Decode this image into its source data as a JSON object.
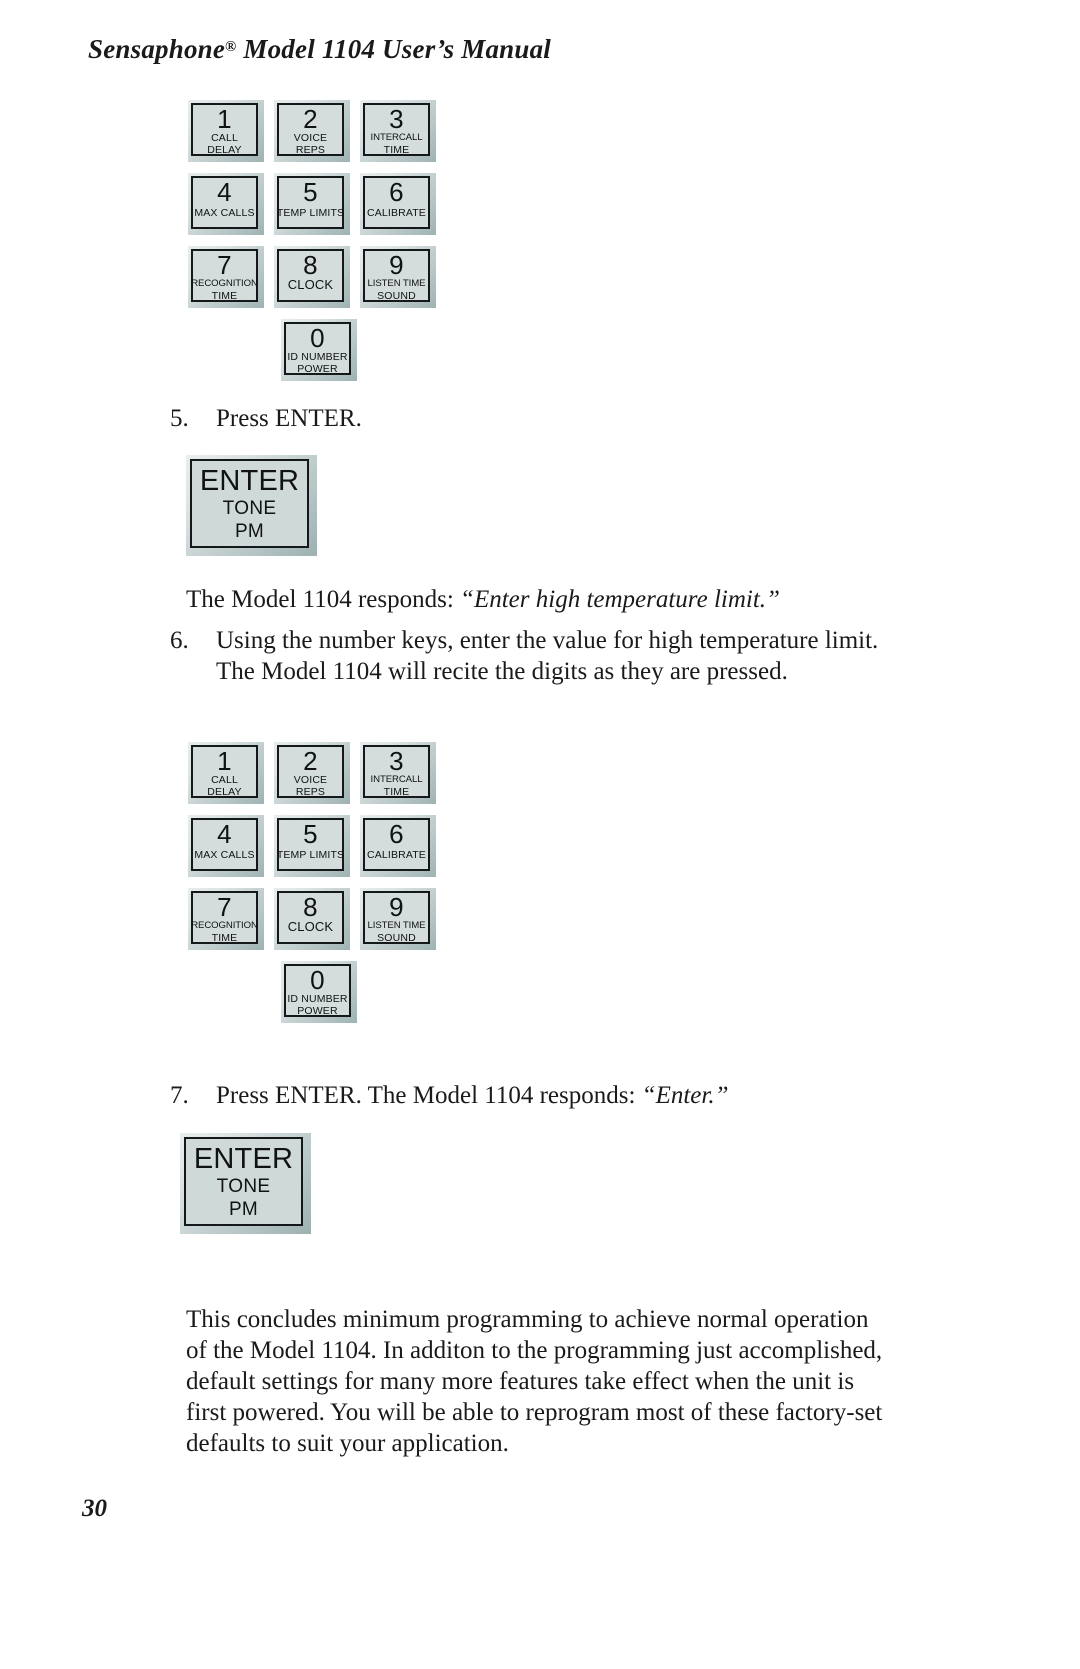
{
  "header": {
    "brand": "Sensaphone",
    "registered_mark": "®",
    "title_rest": " Model 1104 User’s Manual"
  },
  "keypad": {
    "keys": [
      {
        "digit": "1",
        "sub1": "CALL",
        "sub2": "DELAY"
      },
      {
        "digit": "2",
        "sub1": "VOICE",
        "sub2": "REPS"
      },
      {
        "digit": "3",
        "sub1": "INTERCALL",
        "sub2": "TIME"
      },
      {
        "digit": "4",
        "sub1": "MAX CALLS",
        "sub2": ""
      },
      {
        "digit": "5",
        "sub1": "TEMP LIMITS",
        "sub2": ""
      },
      {
        "digit": "6",
        "sub1": "CALIBRATE",
        "sub2": ""
      },
      {
        "digit": "7",
        "sub1": "RECOGNITION",
        "sub2": "TIME"
      },
      {
        "digit": "8",
        "sub1": "CLOCK",
        "sub2": ""
      },
      {
        "digit": "9",
        "sub1": "LISTEN TIME",
        "sub2": "SOUND"
      },
      {
        "digit": "0",
        "sub1": "ID NUMBER",
        "sub2": "POWER"
      }
    ]
  },
  "enter_key": {
    "label": "ENTER",
    "sub1": "TONE",
    "sub2": "PM"
  },
  "steps": {
    "step5": {
      "number": "5.",
      "text": "Press ENTER."
    },
    "response5": {
      "lead": "The Model 1104 responds: ",
      "quote": "“Enter high temperature limit.”"
    },
    "step6": {
      "number": "6.",
      "text": "Using the number keys, enter the value for high temperature limit. The Model 1104 will recite the digits as they are pressed."
    },
    "step7": {
      "number": "7.",
      "lead": "Press ENTER. The Model 1104 responds: ",
      "quote": "“Enter.”"
    }
  },
  "closing_paragraph": "This concludes minimum programming to achieve normal operation of the Model 1104. In additon to the programming just accomplished, default settings for many more features take effect when the unit is first powered. You will be able to reprogram most of these factory-set defaults to suit your application.",
  "page_number": "30",
  "colors": {
    "page_background": "#ffffff",
    "text": "#1a1a1a",
    "key_face": "#d4dcdc",
    "key_border": "#14181a",
    "key_bevel_light": "#e7ecec",
    "key_bevel_dark": "#9fb3b3"
  }
}
